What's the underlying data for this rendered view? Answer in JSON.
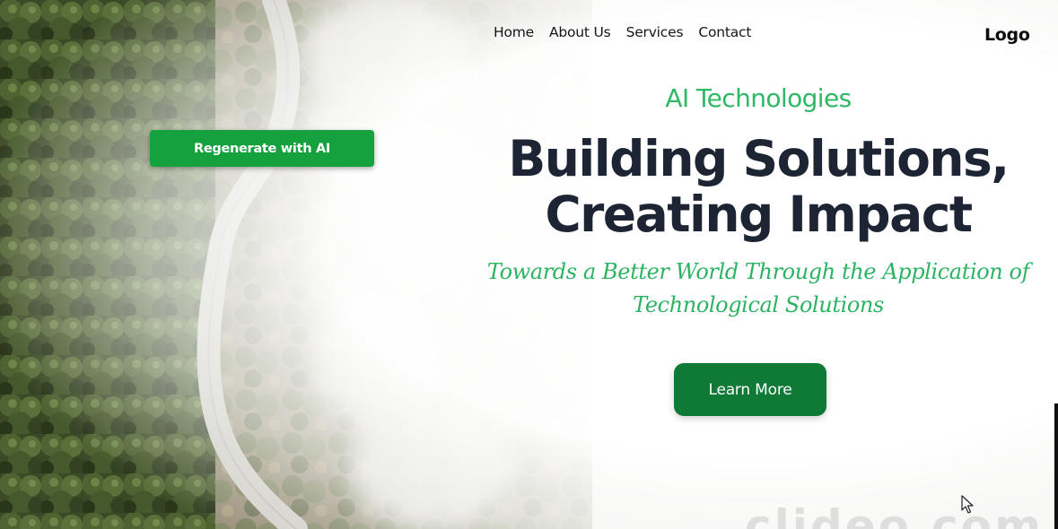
{
  "nav": {
    "items": [
      {
        "label": "Home"
      },
      {
        "label": "About Us"
      },
      {
        "label": "Services"
      },
      {
        "label": "Contact"
      }
    ],
    "logo": "Logo"
  },
  "hero": {
    "eyebrow": "AI Technologies",
    "headline_line1": "Building Solutions,",
    "headline_line2": "Creating Impact",
    "tagline_line1": "Towards a Better World Through the Application of",
    "tagline_line2": "Technological Solutions",
    "cta_label": "Learn More"
  },
  "editor": {
    "regenerate_label": "Regenerate with AI"
  },
  "watermark": "clideo.com",
  "colors": {
    "accent_green": "#2fb866",
    "cta_green": "#0e7a36",
    "regen_green": "#16a13f",
    "headline": "#1d2433",
    "forest_dark": "#2f3d1f",
    "road": "#cfcfcb"
  },
  "icons": {
    "cursor": "mouse-pointer-icon"
  }
}
